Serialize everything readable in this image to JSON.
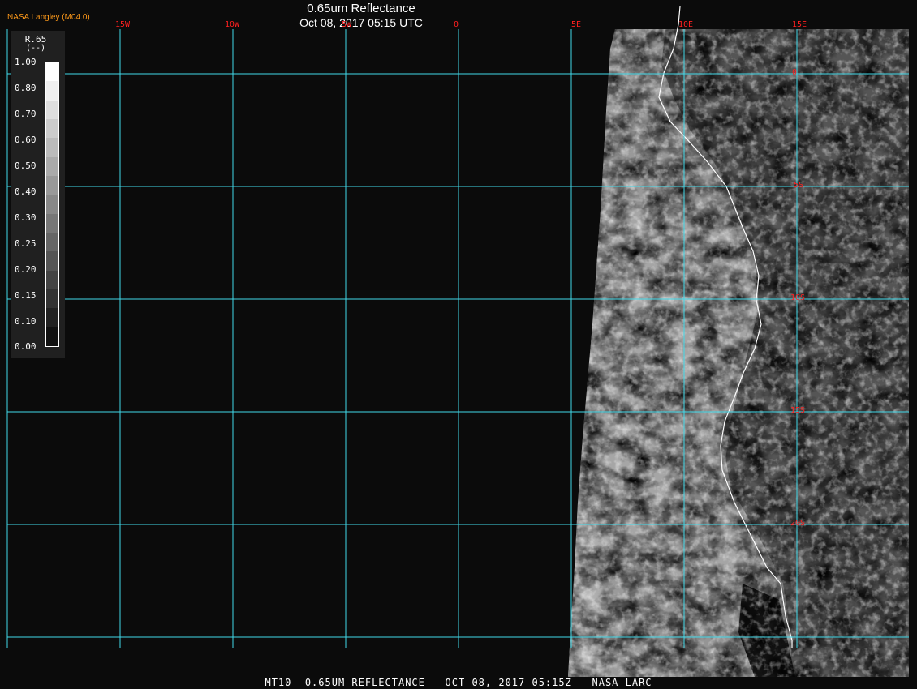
{
  "header": {
    "org": "NASA Langley (M04.0)",
    "title": "0.65um Reflectance",
    "datetime": "Oct 08, 2017 05:15 UTC"
  },
  "footer": {
    "text": "MT10  0.65UM REFLECTANCE   OCT 08, 2017 05:15Z   NASA LARC"
  },
  "legend": {
    "variable": "R.65",
    "unit": "(--)",
    "ticks": [
      "1.00",
      "0.80",
      "0.70",
      "0.60",
      "0.50",
      "0.40",
      "0.30",
      "0.25",
      "0.20",
      "0.15",
      "0.10",
      "0.00"
    ],
    "shades": [
      "#ffffff",
      "#f0f0f0",
      "#dedede",
      "#cccccc",
      "#bbbbbb",
      "#aaaaaa",
      "#999999",
      "#888888",
      "#777777",
      "#666666",
      "#555555",
      "#444444",
      "#333333",
      "#222222",
      "#111111"
    ]
  },
  "grid": {
    "lon_labels": [
      "15W",
      "10W",
      "5W",
      "0",
      "5E",
      "10E",
      "15E"
    ],
    "lat_labels": [
      "0",
      "5S",
      "10S",
      "15S",
      "20S"
    ]
  },
  "colors": {
    "gridline": "#40d8e8",
    "grid_label": "#ff2020",
    "space": "#0b0b0b",
    "coastline": "#ffffff"
  }
}
